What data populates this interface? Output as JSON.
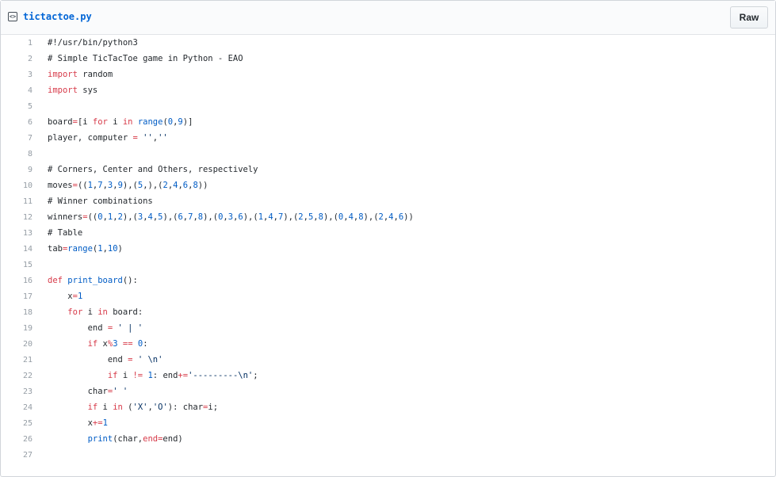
{
  "header": {
    "file_icon": "code-file-icon",
    "file_name": "tictactoe.py",
    "raw_label": "Raw"
  },
  "colors": {
    "keyword": "#d73a49",
    "number": "#005cc5",
    "string": "#032f62",
    "text": "#24292e",
    "link": "#0366d6"
  },
  "code_lines": [
    {
      "n": "1",
      "t": [
        [
          "c",
          "#!/usr/bin/python3"
        ]
      ]
    },
    {
      "n": "2",
      "t": [
        [
          "c",
          "# Simple TicTacToe game in Python - EAO"
        ]
      ]
    },
    {
      "n": "3",
      "t": [
        [
          "k",
          "import"
        ],
        [
          "c",
          " random"
        ]
      ]
    },
    {
      "n": "4",
      "t": [
        [
          "k",
          "import"
        ],
        [
          "c",
          " sys"
        ]
      ]
    },
    {
      "n": "5",
      "t": []
    },
    {
      "n": "6",
      "t": [
        [
          "c",
          "board"
        ],
        [
          "k",
          "="
        ],
        [
          "c",
          "[i "
        ],
        [
          "k",
          "for"
        ],
        [
          "c",
          " i "
        ],
        [
          "k",
          "in"
        ],
        [
          "c",
          " "
        ],
        [
          "n",
          "range"
        ],
        [
          "c",
          "("
        ],
        [
          "n",
          "0"
        ],
        [
          "c",
          ","
        ],
        [
          "n",
          "9"
        ],
        [
          "c",
          ")]"
        ]
      ]
    },
    {
      "n": "7",
      "t": [
        [
          "c",
          "player, computer "
        ],
        [
          "k",
          "="
        ],
        [
          "c",
          " "
        ],
        [
          "s",
          "''"
        ],
        [
          "c",
          ","
        ],
        [
          "s",
          "''"
        ]
      ]
    },
    {
      "n": "8",
      "t": []
    },
    {
      "n": "9",
      "t": [
        [
          "c",
          "# Corners, Center and Others, respectively"
        ]
      ]
    },
    {
      "n": "10",
      "t": [
        [
          "c",
          "moves"
        ],
        [
          "k",
          "="
        ],
        [
          "c",
          "(("
        ],
        [
          "n",
          "1"
        ],
        [
          "c",
          ","
        ],
        [
          "n",
          "7"
        ],
        [
          "c",
          ","
        ],
        [
          "n",
          "3"
        ],
        [
          "c",
          ","
        ],
        [
          "n",
          "9"
        ],
        [
          "c",
          "),("
        ],
        [
          "n",
          "5"
        ],
        [
          "c",
          ",),("
        ],
        [
          "n",
          "2"
        ],
        [
          "c",
          ","
        ],
        [
          "n",
          "4"
        ],
        [
          "c",
          ","
        ],
        [
          "n",
          "6"
        ],
        [
          "c",
          ","
        ],
        [
          "n",
          "8"
        ],
        [
          "c",
          "))"
        ]
      ]
    },
    {
      "n": "11",
      "t": [
        [
          "c",
          "# Winner combinations"
        ]
      ]
    },
    {
      "n": "12",
      "t": [
        [
          "c",
          "winners"
        ],
        [
          "k",
          "="
        ],
        [
          "c",
          "(("
        ],
        [
          "n",
          "0"
        ],
        [
          "c",
          ","
        ],
        [
          "n",
          "1"
        ],
        [
          "c",
          ","
        ],
        [
          "n",
          "2"
        ],
        [
          "c",
          "),("
        ],
        [
          "n",
          "3"
        ],
        [
          "c",
          ","
        ],
        [
          "n",
          "4"
        ],
        [
          "c",
          ","
        ],
        [
          "n",
          "5"
        ],
        [
          "c",
          "),("
        ],
        [
          "n",
          "6"
        ],
        [
          "c",
          ","
        ],
        [
          "n",
          "7"
        ],
        [
          "c",
          ","
        ],
        [
          "n",
          "8"
        ],
        [
          "c",
          "),("
        ],
        [
          "n",
          "0"
        ],
        [
          "c",
          ","
        ],
        [
          "n",
          "3"
        ],
        [
          "c",
          ","
        ],
        [
          "n",
          "6"
        ],
        [
          "c",
          "),("
        ],
        [
          "n",
          "1"
        ],
        [
          "c",
          ","
        ],
        [
          "n",
          "4"
        ],
        [
          "c",
          ","
        ],
        [
          "n",
          "7"
        ],
        [
          "c",
          "),("
        ],
        [
          "n",
          "2"
        ],
        [
          "c",
          ","
        ],
        [
          "n",
          "5"
        ],
        [
          "c",
          ","
        ],
        [
          "n",
          "8"
        ],
        [
          "c",
          "),("
        ],
        [
          "n",
          "0"
        ],
        [
          "c",
          ","
        ],
        [
          "n",
          "4"
        ],
        [
          "c",
          ","
        ],
        [
          "n",
          "8"
        ],
        [
          "c",
          "),("
        ],
        [
          "n",
          "2"
        ],
        [
          "c",
          ","
        ],
        [
          "n",
          "4"
        ],
        [
          "c",
          ","
        ],
        [
          "n",
          "6"
        ],
        [
          "c",
          "))"
        ]
      ]
    },
    {
      "n": "13",
      "t": [
        [
          "c",
          "# Table"
        ]
      ]
    },
    {
      "n": "14",
      "t": [
        [
          "c",
          "tab"
        ],
        [
          "k",
          "="
        ],
        [
          "n",
          "range"
        ],
        [
          "c",
          "("
        ],
        [
          "n",
          "1"
        ],
        [
          "c",
          ","
        ],
        [
          "n",
          "10"
        ],
        [
          "c",
          ")"
        ]
      ]
    },
    {
      "n": "15",
      "t": []
    },
    {
      "n": "16",
      "t": [
        [
          "k",
          "def"
        ],
        [
          "c",
          " "
        ],
        [
          "n",
          "print_board"
        ],
        [
          "c",
          "():"
        ]
      ]
    },
    {
      "n": "17",
      "t": [
        [
          "c",
          "    x"
        ],
        [
          "k",
          "="
        ],
        [
          "n",
          "1"
        ]
      ]
    },
    {
      "n": "18",
      "t": [
        [
          "c",
          "    "
        ],
        [
          "k",
          "for"
        ],
        [
          "c",
          " i "
        ],
        [
          "k",
          "in"
        ],
        [
          "c",
          " board:"
        ]
      ]
    },
    {
      "n": "19",
      "t": [
        [
          "c",
          "        end "
        ],
        [
          "k",
          "="
        ],
        [
          "c",
          " "
        ],
        [
          "s",
          "' | '"
        ]
      ]
    },
    {
      "n": "20",
      "t": [
        [
          "c",
          "        "
        ],
        [
          "k",
          "if"
        ],
        [
          "c",
          " x"
        ],
        [
          "k",
          "%"
        ],
        [
          "n",
          "3"
        ],
        [
          "c",
          " "
        ],
        [
          "k",
          "=="
        ],
        [
          "c",
          " "
        ],
        [
          "n",
          "0"
        ],
        [
          "c",
          ":"
        ]
      ]
    },
    {
      "n": "21",
      "t": [
        [
          "c",
          "            end "
        ],
        [
          "k",
          "="
        ],
        [
          "c",
          " "
        ],
        [
          "s",
          "' \\n'"
        ]
      ]
    },
    {
      "n": "22",
      "t": [
        [
          "c",
          "            "
        ],
        [
          "k",
          "if"
        ],
        [
          "c",
          " i "
        ],
        [
          "k",
          "!="
        ],
        [
          "c",
          " "
        ],
        [
          "n",
          "1"
        ],
        [
          "c",
          ": end"
        ],
        [
          "k",
          "+="
        ],
        [
          "s",
          "'---------\\n'"
        ],
        [
          "c",
          ";"
        ]
      ]
    },
    {
      "n": "23",
      "t": [
        [
          "c",
          "        char"
        ],
        [
          "k",
          "="
        ],
        [
          "s",
          "' '"
        ]
      ]
    },
    {
      "n": "24",
      "t": [
        [
          "c",
          "        "
        ],
        [
          "k",
          "if"
        ],
        [
          "c",
          " i "
        ],
        [
          "k",
          "in"
        ],
        [
          "c",
          " ("
        ],
        [
          "s",
          "'X'"
        ],
        [
          "c",
          ","
        ],
        [
          "s",
          "'O'"
        ],
        [
          "c",
          "): char"
        ],
        [
          "k",
          "="
        ],
        [
          "c",
          "i;"
        ]
      ]
    },
    {
      "n": "25",
      "t": [
        [
          "c",
          "        x"
        ],
        [
          "k",
          "+="
        ],
        [
          "n",
          "1"
        ]
      ]
    },
    {
      "n": "26",
      "t": [
        [
          "c",
          "        "
        ],
        [
          "n",
          "print"
        ],
        [
          "c",
          "(char,"
        ],
        [
          "k",
          "end"
        ],
        [
          "k",
          "="
        ],
        [
          "c",
          "end)"
        ]
      ]
    },
    {
      "n": "27",
      "t": []
    }
  ]
}
